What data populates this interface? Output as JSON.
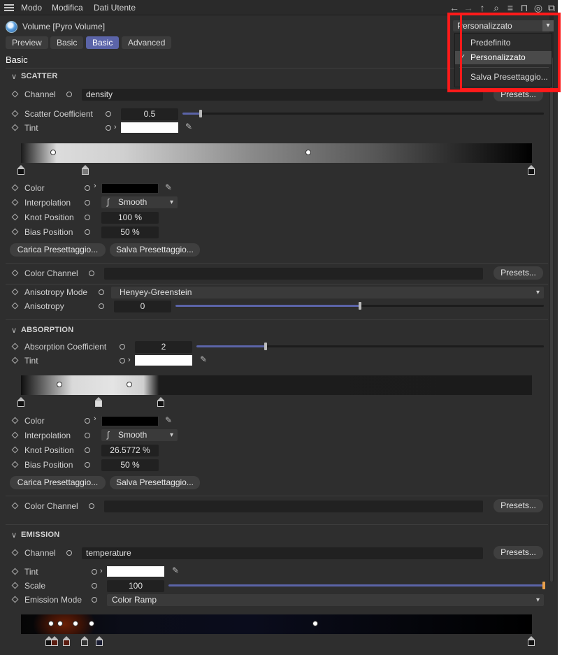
{
  "menubar": {
    "items": [
      "Modo",
      "Modifica",
      "Dati Utente"
    ]
  },
  "toolbar_icons": [
    "back-arrow-icon",
    "forward-arrow-icon",
    "up-arrow-icon",
    "search-icon",
    "filter-icon",
    "lock-icon",
    "target-icon",
    "popout-icon"
  ],
  "object": {
    "title": "Volume [Pyro Volume]"
  },
  "tabs": [
    "Preview",
    "Basic",
    "Basic",
    "Advanced"
  ],
  "active_tab_index": 2,
  "section_header": "Basic",
  "preset_dropdown": {
    "value": "Personalizzato",
    "menu": {
      "items": [
        "Predefinito",
        "Personalizzato",
        "Salva Presettaggio..."
      ],
      "checked_index": 1
    }
  },
  "scatter": {
    "title": "SCATTER",
    "channel_label": "Channel",
    "channel_value": "density",
    "presets_label": "Presets...",
    "coef_label": "Scatter Coefficient",
    "coef_value": "0.5",
    "coef_fraction": 0.05,
    "tint_label": "Tint",
    "color_label": "Color",
    "interp_label": "Interpolation",
    "interp_value": "Smooth",
    "knot_label": "Knot Position",
    "knot_value": "100 %",
    "bias_label": "Bias Position",
    "bias_value": "50 %",
    "load_preset": "Carica Presettaggio...",
    "save_preset": "Salva Presettaggio...",
    "color_channel_label": "Color Channel",
    "color_channel_presets": "Presets...",
    "aniso_mode_label": "Anisotropy Mode",
    "aniso_mode_value": "Henyey-Greenstein",
    "aniso_label": "Anisotropy",
    "aniso_value": "0",
    "aniso_fraction": 0.5
  },
  "absorption": {
    "title": "ABSORPTION",
    "coef_label": "Absorption Coefficient",
    "coef_value": "2",
    "coef_fraction": 0.2,
    "tint_label": "Tint",
    "color_label": "Color",
    "interp_label": "Interpolation",
    "interp_value": "Smooth",
    "knot_label": "Knot Position",
    "knot_value": "26.5772 %",
    "bias_label": "Bias Position",
    "bias_value": "50 %",
    "load_preset": "Carica Presettaggio...",
    "save_preset": "Salva Presettaggio...",
    "color_channel_label": "Color Channel",
    "color_channel_presets": "Presets..."
  },
  "emission": {
    "title": "EMISSION",
    "channel_label": "Channel",
    "channel_value": "temperature",
    "presets_label": "Presets...",
    "tint_label": "Tint",
    "scale_label": "Scale",
    "scale_value": "100",
    "scale_fraction": 1.0,
    "mode_label": "Emission Mode",
    "mode_value": "Color Ramp"
  },
  "colors": {
    "accent": "#5b64a8",
    "highlight": "#ff1a1a",
    "panel": "#2e2e2e"
  }
}
